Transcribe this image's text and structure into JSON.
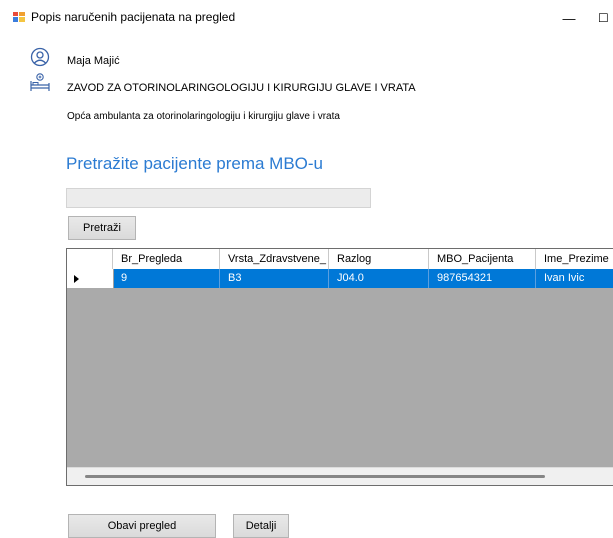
{
  "window": {
    "title": "Popis naručenih pacijenata na pregled",
    "minimize_glyph": "—",
    "maximize_glyph": "☐"
  },
  "header": {
    "user_name": "Maja Majić",
    "department": "ZAVOD ZA OTORINOLARINGOLOGIJU I KIRURGIJU GLAVE I VRATA",
    "clinic": "Opća ambulanta za otorinolaringologiju i kirurgiju glave i vrata"
  },
  "search": {
    "title": "Pretražite pacijente prema MBO-u",
    "input_value": "",
    "button_label": "Pretraži"
  },
  "grid": {
    "columns": [
      "Br_Pregleda",
      "Vrsta_Zdravstvene_",
      "Razlog",
      "MBO_Pacijenta",
      "Ime_Prezime"
    ],
    "rows": [
      [
        "9",
        "B3",
        "J04.0",
        "987654321",
        "Ivan Ivic"
      ]
    ],
    "selected_row": 0
  },
  "actions": {
    "perform_label": "Obavi pregled",
    "details_label": "Detalji"
  },
  "icons": {
    "app": "app-window-icon",
    "user": "user-circle-icon",
    "bed": "hospital-bed-icon"
  },
  "colors": {
    "accent": "#2b7bd2",
    "selection": "#0078d7",
    "grid_background": "#aaaaaa"
  }
}
